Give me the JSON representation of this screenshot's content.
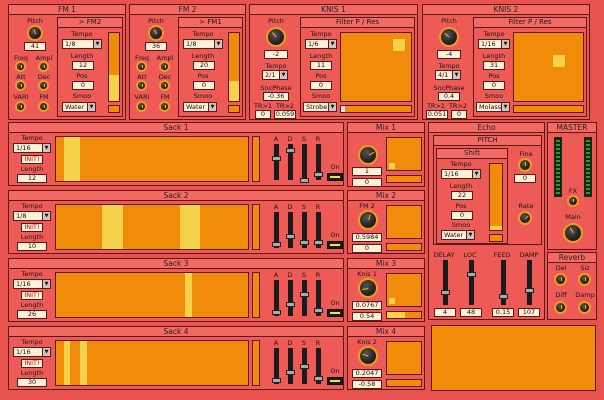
{
  "fm1": {
    "title": "FM 1",
    "pitch_label": "Pitch",
    "pitch": "41",
    "freq": "Freq",
    "ampl": "Ampl",
    "att": "Att",
    "dec": "Dec",
    "vari": "VARI",
    "fm": "FM",
    "tab": "> FM2",
    "tempo_label": "Tempo",
    "tempo": "1/8",
    "length_label": "Length",
    "length": "12",
    "pos_label": "Pos",
    "pos": "0",
    "smoo_label": "Smoo",
    "smoo": "Water"
  },
  "fm2": {
    "title": "FM 2",
    "pitch_label": "Pitch",
    "pitch": "36",
    "freq": "Freq",
    "ampl": "Ampl",
    "att": "Att",
    "dec": "Dec",
    "vari": "VARI",
    "fm": "FM",
    "tab": "> FM1",
    "tempo_label": "Tempo",
    "tempo": "1/8",
    "length_label": "Length",
    "length": "20",
    "pos_label": "Pos",
    "pos": "0",
    "smoo_label": "Smoo",
    "smoo": "Water"
  },
  "knis1": {
    "title": "KNIS 1",
    "pitch_label": "Pitch",
    "pitch": "-2",
    "tempo_label": "Tempo",
    "tempo": "2/1",
    "sncphase_label": "SncPhase",
    "sncphase": "-0.36",
    "tr1": "TR>1",
    "tr2": "TR>2",
    "tr1v": "0",
    "tr2v": "0.059",
    "filter": "Filter P / Res",
    "tempo2_label": "Tempo",
    "tempo2": "1/6",
    "length_label": "Length",
    "length": "11",
    "pos_label": "Pos",
    "pos": "0",
    "smoo_label": "Smoo",
    "smoo": "Strobe"
  },
  "knis2": {
    "title": "KNIS 2",
    "pitch_label": "Pitch",
    "pitch": "-4",
    "tempo_label": "Tempo",
    "tempo": "4/1",
    "sncphase_label": "SncPhase",
    "sncphase": "0.4",
    "tr1": "TR>1",
    "tr2": "TR>2",
    "tr1v": "0.051",
    "tr2v": "0",
    "filter": "Filter P / Res",
    "tempo2_label": "Tempo",
    "tempo2": "1/16",
    "length_label": "Length",
    "length": "31",
    "pos_label": "Pos",
    "pos": "0",
    "smoo_label": "Smoo",
    "smoo": "Molass"
  },
  "sacks": [
    {
      "title": "Sack 1",
      "tempo_label": "Tempo",
      "tempo": "1/16",
      "init": "INIT!",
      "length_label": "Length",
      "length": "12"
    },
    {
      "title": "Sack 2",
      "tempo_label": "Tempo",
      "tempo": "1/8",
      "init": "INIT!",
      "length_label": "Length",
      "length": "10"
    },
    {
      "title": "Sack 3",
      "tempo_label": "Tempo",
      "tempo": "1/16",
      "init": "INIT!",
      "length_label": "Length",
      "length": "26"
    },
    {
      "title": "Sack 4",
      "tempo_label": "Tempo",
      "tempo": "1/16",
      "init": "INIT!",
      "length_label": "Length",
      "length": "30"
    }
  ],
  "adsr": [
    "A",
    "D",
    "S",
    "R"
  ],
  "on_label": "On",
  "mixes": [
    {
      "title": "Mix 1",
      "v1": "1",
      "v2": "0"
    },
    {
      "title": "Mix 2",
      "knob_label": "FM 2",
      "v1": "0.5984",
      "v2": "0"
    },
    {
      "title": "Mix 3",
      "knob_label": "Knis 1",
      "v1": "0.0767",
      "v2": "0.54"
    },
    {
      "title": "Mix 4",
      "knob_label": "Knis 2",
      "v1": "0.2047",
      "v2": "-0.58"
    }
  ],
  "echo": {
    "title": "Echo",
    "pitch": "PITCH",
    "shift": "Shift",
    "tempo_label": "Tempo",
    "tempo": "1/16",
    "length_label": "Length",
    "length": "22",
    "pos_label": "Pos",
    "pos": "0",
    "smoo_label": "Smoo",
    "smoo": "Water",
    "fine_label": "Fine",
    "fine": "0",
    "rate_label": "Rate",
    "delay": "DELAY",
    "loc": "LOC",
    "feed": "FEED",
    "damp": "DAMP",
    "delay_v": "4",
    "loc_v": "48",
    "feed_v": "0.15",
    "damp_v": "107"
  },
  "master": {
    "title": "MASTER",
    "fx": "FX",
    "main": "Main"
  },
  "reverb": {
    "title": "Reverb",
    "del": "Del",
    "siz": "Siz",
    "diff": "Diff",
    "damp": "Damp"
  }
}
